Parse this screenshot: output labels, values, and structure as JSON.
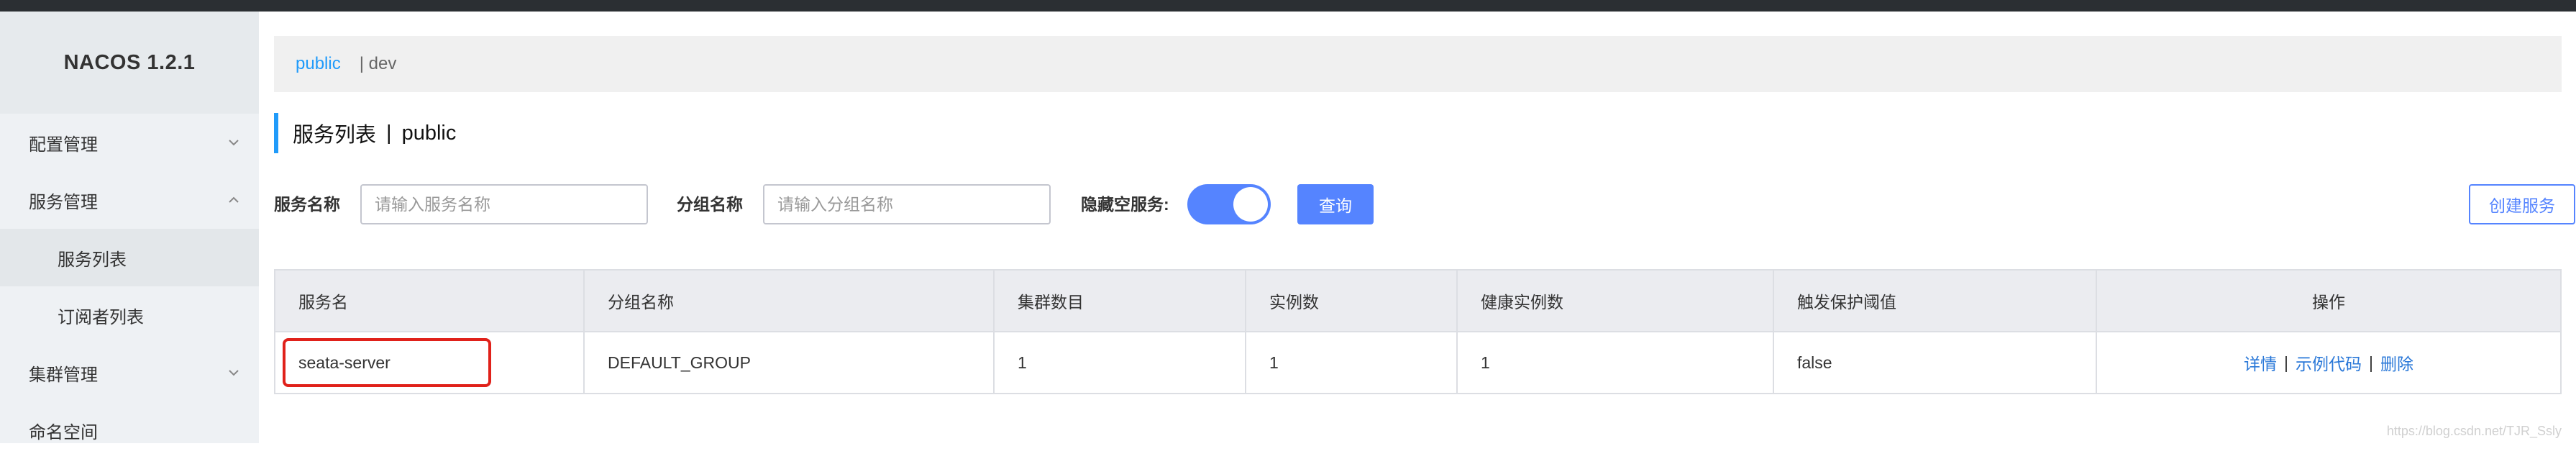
{
  "app": {
    "title": "NACOS 1.2.1"
  },
  "sidebar": {
    "items": [
      {
        "label": "配置管理",
        "expanded": false
      },
      {
        "label": "服务管理",
        "expanded": true,
        "children": [
          "服务列表",
          "订阅者列表"
        ]
      },
      {
        "label": "集群管理",
        "expanded": false
      },
      {
        "label": "命名空间"
      }
    ],
    "active_child": "服务列表"
  },
  "namespaces": {
    "active": "public",
    "separator": "| dev"
  },
  "page": {
    "title": "服务列表",
    "sep": "|",
    "namespace": "public"
  },
  "filters": {
    "service_name_label": "服务名称",
    "service_name_placeholder": "请输入服务名称",
    "group_name_label": "分组名称",
    "group_name_placeholder": "请输入分组名称",
    "hide_empty_label": "隐藏空服务:",
    "hide_empty_on": true,
    "query_button": "查询",
    "create_button": "创建服务"
  },
  "table": {
    "headers": [
      "服务名",
      "分组名称",
      "集群数目",
      "实例数",
      "健康实例数",
      "触发保护阈值",
      "操作"
    ],
    "rows": [
      {
        "name": "seata-server",
        "group": "DEFAULT_GROUP",
        "clusters": "1",
        "instances": "1",
        "healthy": "1",
        "threshold": "false",
        "ops": [
          "详情",
          "示例代码",
          "删除"
        ],
        "op_sep": "|"
      }
    ]
  },
  "watermark": "https://blog.csdn.net/TJR_Ssly",
  "colors": {
    "accent": "#209bfa",
    "primary": "#5584ff",
    "highlight": "#e0211a"
  }
}
